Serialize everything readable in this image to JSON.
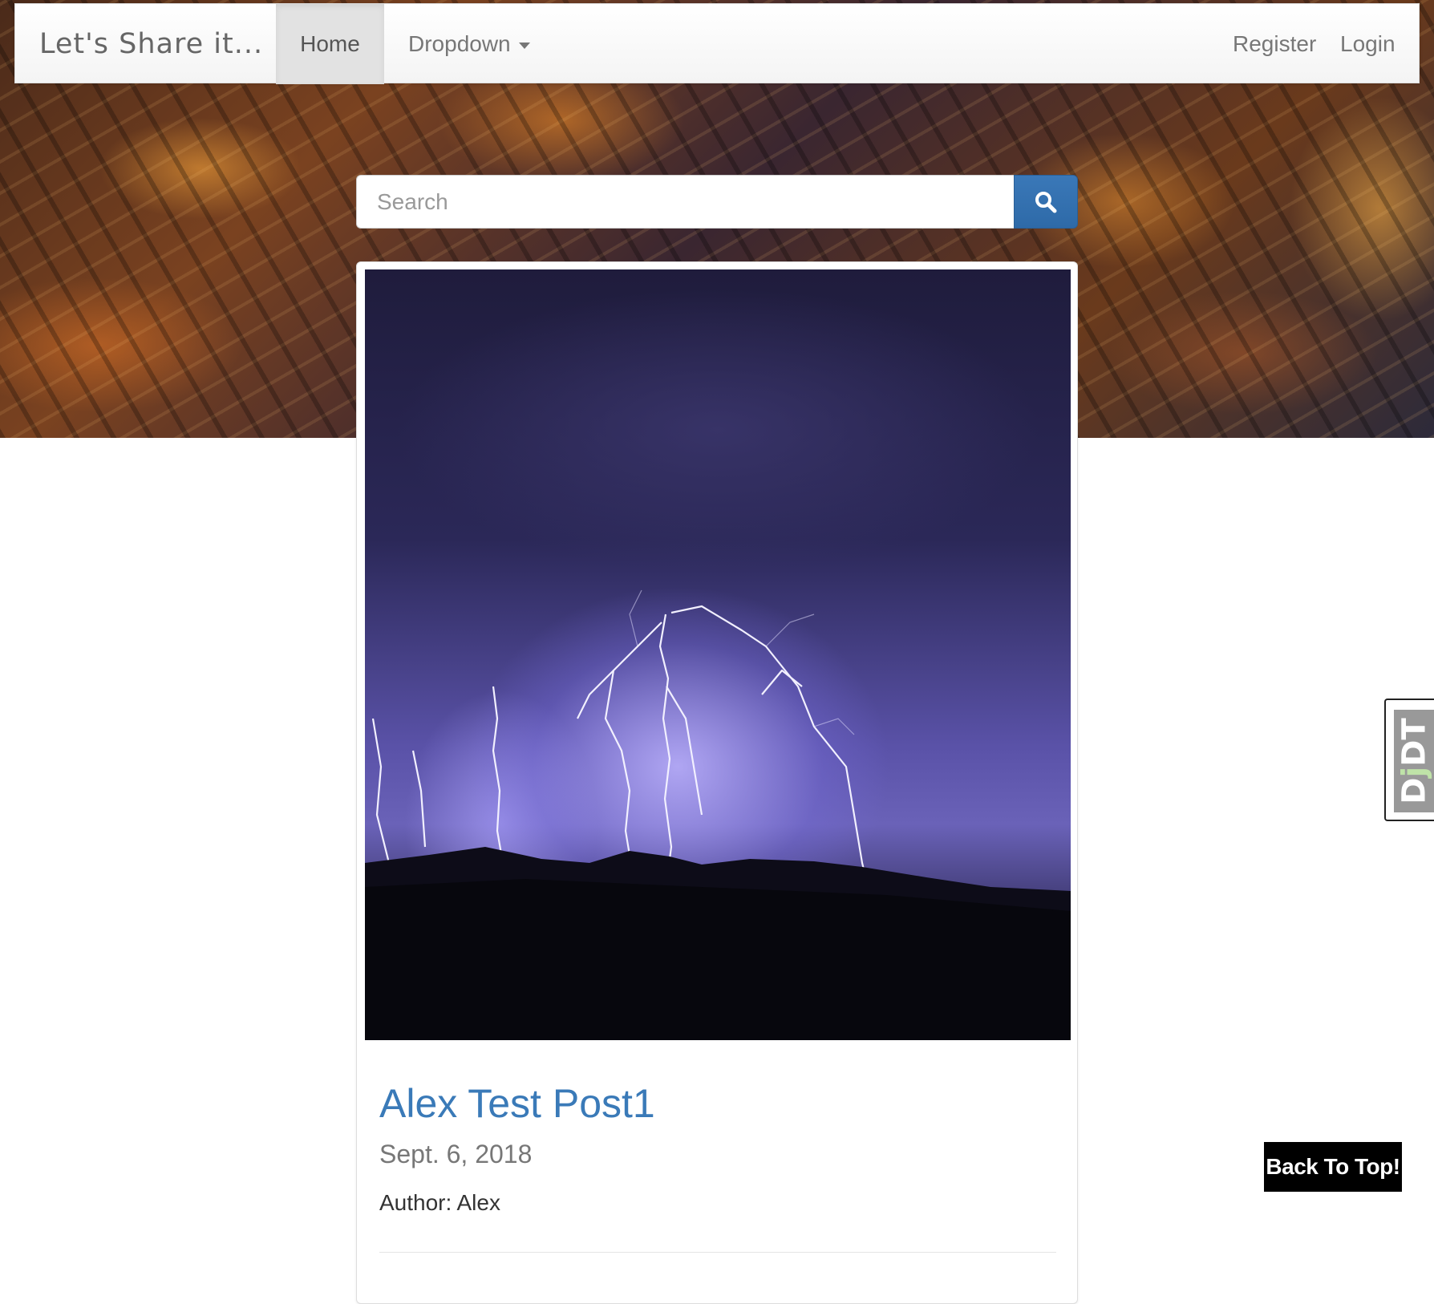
{
  "navbar": {
    "brand": "Let's Share it...",
    "home_label": "Home",
    "dropdown_label": "Dropdown",
    "register_label": "Register",
    "login_label": "Login"
  },
  "search": {
    "placeholder": "Search",
    "value": "",
    "button_icon": "search-icon"
  },
  "post": {
    "title": "Alex Test Post1",
    "date": "Sept. 6, 2018",
    "author": "Author: Alex"
  },
  "toolbar": {
    "djdt_label_a": "D",
    "djdt_label_b": "j",
    "djdt_label_c": "DT"
  },
  "back_to_top": "Back To Top!",
  "colors": {
    "accent": "#3a7ab8",
    "search_button": "#2e6aa8",
    "nav_active_bg": "#e2e2e2"
  }
}
